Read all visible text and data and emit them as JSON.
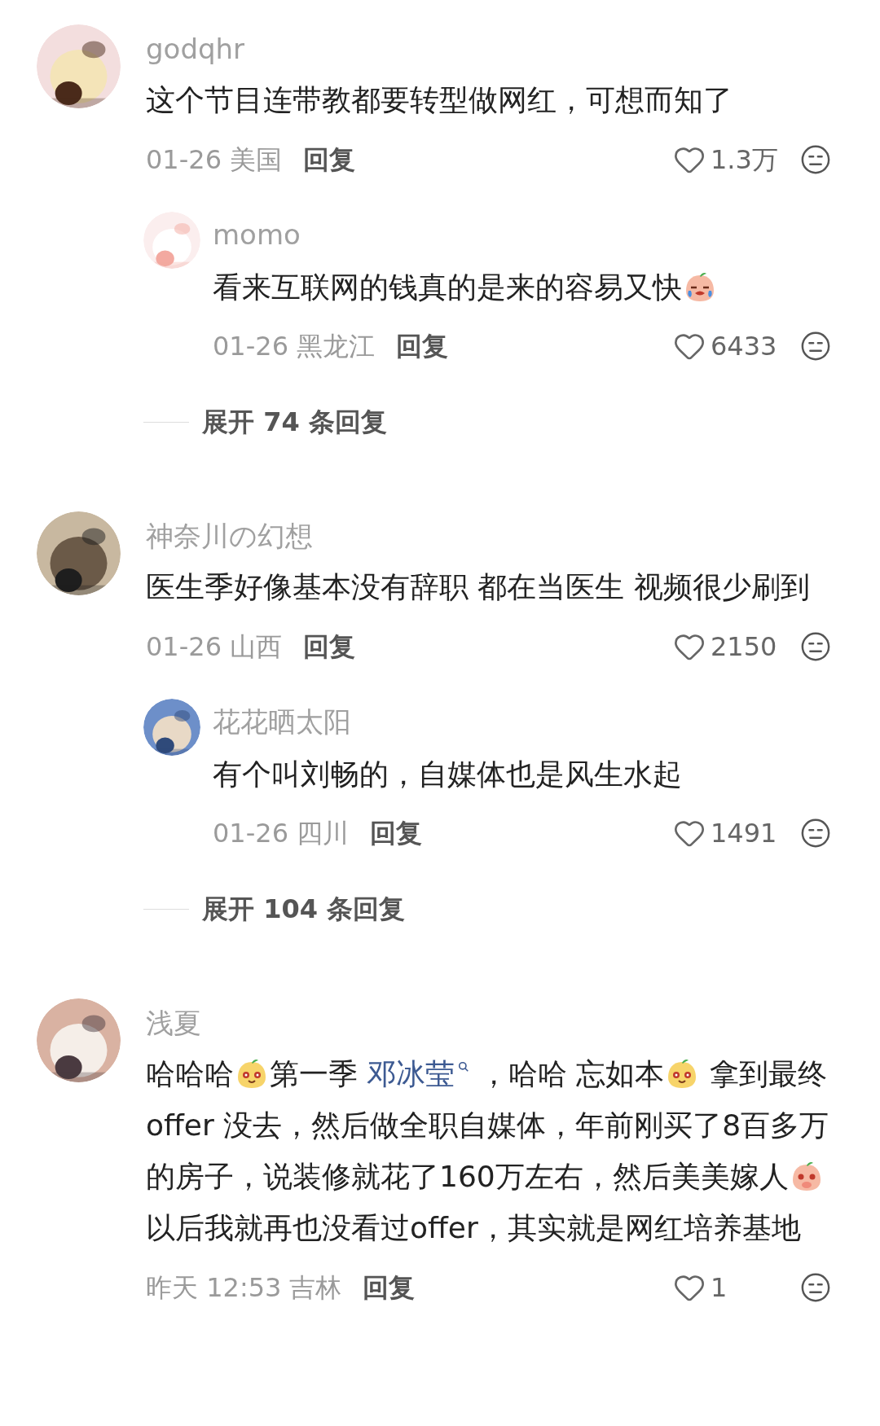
{
  "comments": [
    {
      "user": "godqhr",
      "body": [
        {
          "kind": "text",
          "text": "这个节目连带教都要转型做网红，可想而知了"
        }
      ],
      "date": "01-26",
      "location": "美国",
      "reply_label": "回复",
      "likes": "1.3万",
      "replies": [
        {
          "user": "momo",
          "body": [
            {
              "kind": "text",
              "text": "看来互联网的钱真的是来的容易又快"
            },
            {
              "kind": "cry"
            }
          ],
          "date": "01-26",
          "location": "黑龙江",
          "reply_label": "回复",
          "likes": "6433"
        }
      ],
      "expand": "展开 74 条回复"
    },
    {
      "user": "神奈川の幻想",
      "body": [
        {
          "kind": "text",
          "text": "医生季好像基本没有辞职 都在当医生 视频很少刷到"
        }
      ],
      "date": "01-26",
      "location": "山西",
      "reply_label": "回复",
      "likes": "2150",
      "replies": [
        {
          "user": "花花晒太阳",
          "body": [
            {
              "kind": "text",
              "text": "有个叫刘畅的，自媒体也是风生水起"
            }
          ],
          "date": "01-26",
          "location": "四川",
          "reply_label": "回复",
          "likes": "1491"
        }
      ],
      "expand": "展开 104 条回复"
    },
    {
      "user": "浅夏",
      "body": [
        {
          "kind": "text",
          "text": "哈哈哈"
        },
        {
          "kind": "grin"
        },
        {
          "kind": "text",
          "text": "第一季 "
        },
        {
          "kind": "mention",
          "text": "邓冰莹"
        },
        {
          "kind": "text",
          "text": " ，哈哈 忘如本"
        },
        {
          "kind": "grin"
        },
        {
          "kind": "text",
          "text": " 拿到最终offer 没去，然后做全职自媒体，年前刚买了8百多万的房子，说装修就花了160万左右，然后美美嫁人"
        },
        {
          "kind": "shy"
        },
        {
          "kind": "text",
          "text": " 以后我就再也没看过offer，其实就是网红培养基地"
        }
      ],
      "date": "昨天 12:53",
      "location": "吉林",
      "reply_label": "回复",
      "likes": "1"
    }
  ]
}
